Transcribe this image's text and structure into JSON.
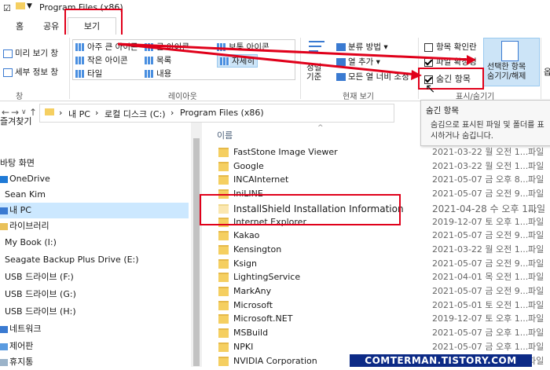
{
  "titlebar": {
    "title": "Program Files (x86)"
  },
  "tabs": {
    "home": "홈",
    "share": "공유",
    "view": "보기"
  },
  "ribbon": {
    "preview_pane": "미리 보기 창",
    "details_pane": "세부 정보 창",
    "pane_group": "창",
    "layout": [
      "아주 큰 아이콘",
      "큰 아이콘",
      "보통 아이콘",
      "작은 아이콘",
      "목록",
      "자세히",
      "타일",
      "내용"
    ],
    "layout_group": "레이아웃",
    "sort_by": "정렬\n기준",
    "group_by": "분류 방법",
    "add_column": "열 추가",
    "fit_columns": "모든 열 너비 조정",
    "current_view_group": "현재 보기",
    "item_checkbox": "항목 확인란",
    "file_ext": "파일 확장명",
    "hidden_items": "숨긴 항목",
    "hide_selected": "선택한 항목\n숨기기/해제",
    "showhide_group": "표시/숨기기",
    "options": "옵"
  },
  "address": {
    "path": [
      "내 PC",
      "로컬 디스크 (C:)",
      "Program Files (x86)"
    ]
  },
  "nav": {
    "quick": "즐겨찾기",
    "items": [
      "바탕 화면",
      "OneDrive",
      "Sean Kim",
      "내 PC",
      "라이브러리",
      "My Book (I:)",
      "Seagate Backup Plus Drive (E:)",
      "USB 드라이브 (F:)",
      "USB 드라이브 (G:)",
      "USB 드라이브 (H:)",
      "네트워크",
      "제어판",
      "휴지통"
    ]
  },
  "list": {
    "header_name": "이름",
    "rows": [
      {
        "name": "FastStone Image Viewer",
        "date": "2021-03-22 월 오전 1...",
        "type": "파일"
      },
      {
        "name": "Google",
        "date": "2021-03-22 월 오전 1...",
        "type": "파일"
      },
      {
        "name": "INCAInternet",
        "date": "2021-05-07 금 오후 8...",
        "type": "파일"
      },
      {
        "name": "IniLINE",
        "date": "2021-05-07 금 오전 9...",
        "type": "파일"
      },
      {
        "name": "InstallShield Installation Information",
        "date": "2021-04-28 수 오후 1...",
        "type": "파일"
      },
      {
        "name": "Internet Explorer",
        "date": "2019-12-07 토 오후 1...",
        "type": "파일"
      },
      {
        "name": "Kakao",
        "date": "2021-05-07 금 오전 9...",
        "type": "파일"
      },
      {
        "name": "Kensington",
        "date": "2021-03-22 월 오전 1...",
        "type": "파일"
      },
      {
        "name": "Ksign",
        "date": "2021-05-07 금 오전 9...",
        "type": "파일"
      },
      {
        "name": "LightingService",
        "date": "2021-04-01 목 오전 1...",
        "type": "파일"
      },
      {
        "name": "MarkAny",
        "date": "2021-05-07 금 오전 9...",
        "type": "파일"
      },
      {
        "name": "Microsoft",
        "date": "2021-05-01 토 오전 1...",
        "type": "파일"
      },
      {
        "name": "Microsoft.NET",
        "date": "2019-12-07 토 오후 1...",
        "type": "파일"
      },
      {
        "name": "MSBuild",
        "date": "2021-05-07 금 오후 1...",
        "type": "파일"
      },
      {
        "name": "NPKI",
        "date": "2021-05-07 금 오후 1...",
        "type": "파일"
      },
      {
        "name": "NVIDIA Corporation",
        "date": "2021-05-04 화 오후 1...",
        "type": "파일"
      }
    ]
  },
  "tooltip": {
    "title": "숨긴 항목",
    "body": "숨김으로 표시된 파일 및 폴더를 표시하거나 숨깁니다."
  },
  "watermark": "COMTERMAN.TISTORY.COM",
  "colors": {
    "highlight_red": "#e0001a",
    "watermark_bg": "#0c2a86",
    "folder": "#f5cf61"
  }
}
